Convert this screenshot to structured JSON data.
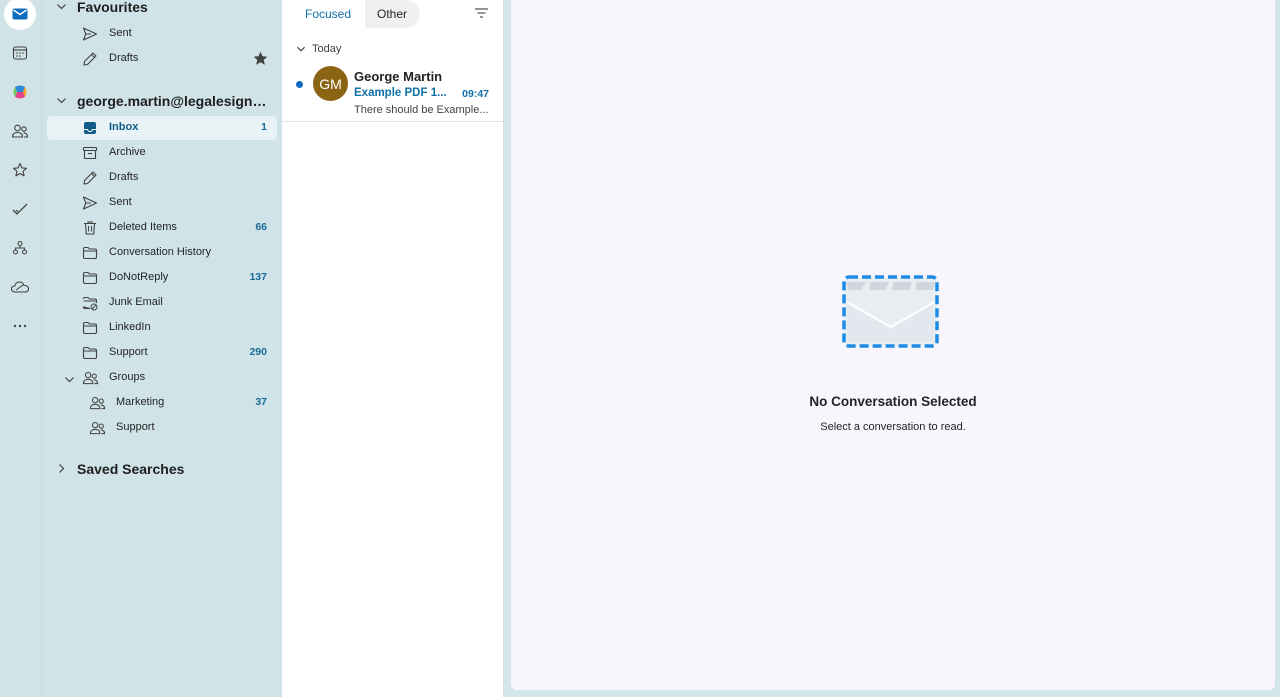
{
  "colors": {
    "accent": "#0f6cbd",
    "link": "#1170a8",
    "avatar": "#8a6413",
    "pane_bg": "#cfe3e8"
  },
  "rail": {
    "items": [
      {
        "name": "mail-icon",
        "active": true
      },
      {
        "name": "calendar-icon"
      },
      {
        "name": "copilot-icon"
      },
      {
        "name": "people-icon"
      },
      {
        "name": "favorites-star-icon"
      },
      {
        "name": "todo-check-icon"
      },
      {
        "name": "org-chart-icon"
      },
      {
        "name": "onedrive-cloud-icon"
      },
      {
        "name": "more-apps-icon"
      }
    ]
  },
  "favourites": {
    "title": "Favourites",
    "items": [
      {
        "label": "Sent",
        "icon": "send-icon"
      },
      {
        "label": "Drafts",
        "icon": "pencil-icon"
      }
    ]
  },
  "account": {
    "title": "george.martin@legalesign....",
    "folders": [
      {
        "label": "Inbox",
        "count": "1",
        "icon": "inbox-icon",
        "selected": true
      },
      {
        "label": "Archive",
        "icon": "archive-icon"
      },
      {
        "label": "Drafts",
        "icon": "pencil-icon"
      },
      {
        "label": "Sent",
        "icon": "send-icon"
      },
      {
        "label": "Deleted Items",
        "count": "66",
        "icon": "trash-icon"
      },
      {
        "label": "Conversation History",
        "icon": "folder-icon"
      },
      {
        "label": "DoNotReply",
        "count": "137",
        "icon": "folder-icon"
      },
      {
        "label": "Junk Email",
        "icon": "junk-icon"
      },
      {
        "label": "LinkedIn",
        "icon": "folder-icon"
      },
      {
        "label": "Support",
        "count": "290",
        "icon": "folder-icon"
      }
    ],
    "groups": {
      "label": "Groups",
      "items": [
        {
          "label": "Marketing",
          "count": "37"
        },
        {
          "label": "Support"
        }
      ]
    }
  },
  "saved_searches": {
    "title": "Saved Searches"
  },
  "message_list": {
    "tabs": {
      "focused": "Focused",
      "other": "Other"
    },
    "section": "Today",
    "messages": [
      {
        "initials": "GM",
        "sender": "George Martin",
        "subject": "Example PDF 1...",
        "time": "09:47",
        "preview": "There should be Example..."
      }
    ]
  },
  "reading_pane": {
    "title": "No Conversation Selected",
    "subtitle": "Select a conversation to read."
  }
}
